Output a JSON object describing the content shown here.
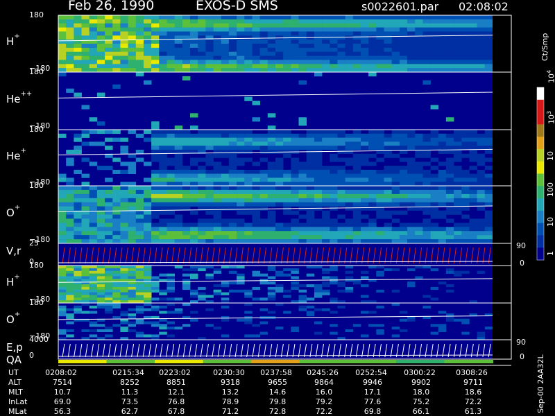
{
  "header": {
    "date": "Feb 26, 1990",
    "mission": "EXOS-D SMS",
    "file": "s0022601.par",
    "time": "02:08:02"
  },
  "colorbar": {
    "unit": "Ct/Smp",
    "labels": [
      "10",
      "10",
      "10",
      "100",
      "10",
      "1"
    ],
    "exp": [
      "4",
      "3",
      "",
      "",
      "",
      ""
    ]
  },
  "panels": [
    {
      "name": "H",
      "sup": "+",
      "ymax": "180",
      "ymin": "−180"
    },
    {
      "name": "He",
      "sup": "++",
      "ymax": "180",
      "ymin": "−180"
    },
    {
      "name": "He",
      "sup": "+",
      "ymax": "180",
      "ymin": "−180"
    },
    {
      "name": "O",
      "sup": "+",
      "ymax": "180",
      "ymin": "−180"
    },
    {
      "name": "V,r",
      "sup": "",
      "ymax": "25",
      "ymin": "0",
      "rmax": "90",
      "rmin": "0"
    },
    {
      "name": "H",
      "sup": "+",
      "ymax": "180",
      "ymin": "−180"
    },
    {
      "name": "O",
      "sup": "+",
      "ymax": "180",
      "ymin": "−180"
    },
    {
      "name": "E,p",
      "sup": "",
      "ymax": "4000",
      "ymin": "0",
      "rmax": "90",
      "rmin": "0"
    }
  ],
  "qa_label": "QA",
  "footer": "Sep-00 2AA32L",
  "chart_data": {
    "type": "heatmap",
    "title": "Feb 26, 1990   EXOS-D SMS",
    "colorbar_ticks": [
      "10^4",
      "10^3",
      "100",
      "10",
      "1"
    ],
    "x_axis": {
      "rows": [
        {
          "name": "UT",
          "values": [
            "0208:02",
            "0215:34",
            "0223:02",
            "0230:30",
            "0237:58",
            "0245:26",
            "0252:54",
            "0300:22",
            "0308:26"
          ]
        },
        {
          "name": "ALT",
          "values": [
            "7514",
            "8252",
            "8851",
            "9318",
            "9655",
            "9864",
            "9946",
            "9902",
            "9711"
          ]
        },
        {
          "name": "MLT",
          "values": [
            "10.7",
            "11.3",
            "12.1",
            "13.2",
            "14.6",
            "16.0",
            "17.1",
            "18.0",
            "18.6"
          ]
        },
        {
          "name": "InLat",
          "values": [
            "69.0",
            "73.5",
            "76.8",
            "78.9",
            "79.8",
            "79.2",
            "77.6",
            "75.2",
            "72.2"
          ]
        },
        {
          "name": "MLat",
          "values": [
            "56.3",
            "62.7",
            "67.8",
            "71.2",
            "72.8",
            "72.2",
            "69.8",
            "66.1",
            "61.3"
          ]
        }
      ]
    }
  }
}
